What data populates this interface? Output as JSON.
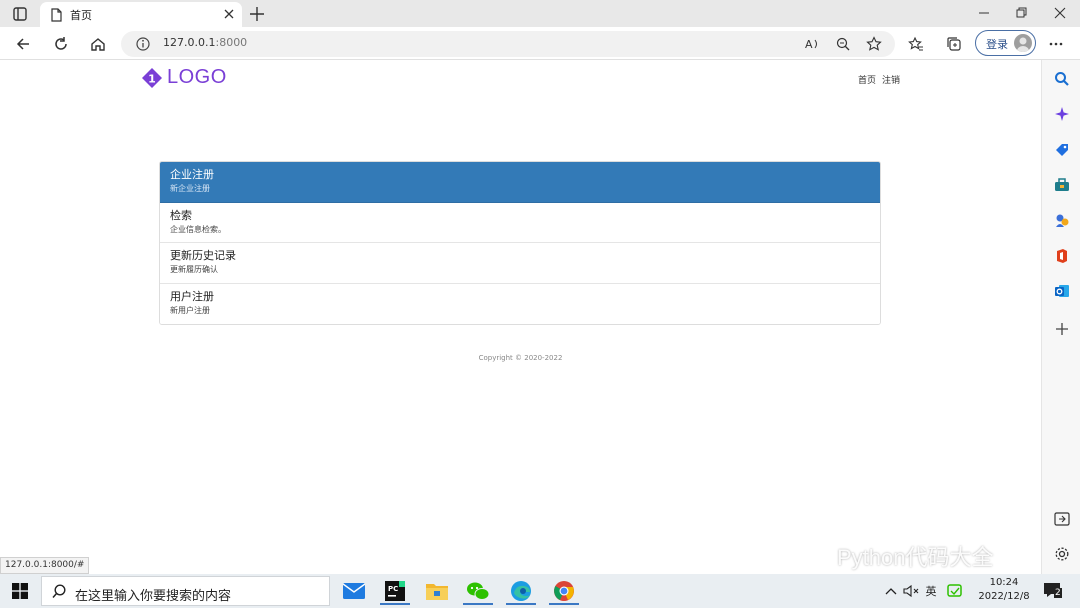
{
  "browser": {
    "tab_title": "首页",
    "url_host": "127.0.0.1",
    "url_port": ":8000",
    "login_label": "登录",
    "status_url": "127.0.0.1:8000/#"
  },
  "page": {
    "logo_text": "LOGO",
    "nav": [
      "首页",
      "注销"
    ],
    "items": [
      {
        "title": "企业注册",
        "desc": "新企业注册",
        "active": true
      },
      {
        "title": "检索",
        "desc": "企业信息检索。",
        "active": false
      },
      {
        "title": "更新历史记录",
        "desc": "更新履历确认",
        "active": false
      },
      {
        "title": "用户注册",
        "desc": "新用户注册",
        "active": false
      }
    ],
    "footer": "Copyright © 2020-2022"
  },
  "watermark": "Python代码大全",
  "taskbar": {
    "search_placeholder": "在这里输入你要搜索的内容",
    "time": "10:24",
    "date": "2022/12/8",
    "ime": "英",
    "notif_count": "2"
  },
  "colors": {
    "accent": "#337ab7",
    "logo": "#7a3fd6"
  }
}
